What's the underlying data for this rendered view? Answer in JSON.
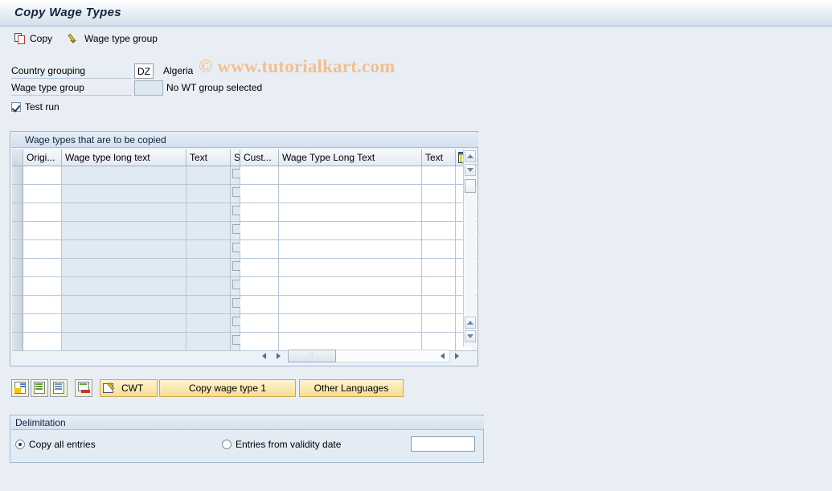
{
  "window": {
    "title": "Copy Wage Types"
  },
  "watermark": "© www.tutorialkart.com",
  "toolbar": {
    "copy_label": "Copy",
    "copy_icon": "copy-icon",
    "wage_type_group_label": "Wage type group",
    "wage_type_group_icon": "pencil-icon"
  },
  "selection": {
    "country_grouping": {
      "label": "Country grouping",
      "value": "DZ",
      "description": "Algeria"
    },
    "wage_type_group": {
      "label": "Wage type group",
      "value": "",
      "description": "No WT group selected"
    },
    "test_run": {
      "label": "Test run",
      "checked": true
    }
  },
  "table": {
    "panel_title": "Wage types that are to be copied",
    "columns": [
      {
        "key": "rowsel",
        "label": "",
        "type": "rowsel"
      },
      {
        "key": "orig",
        "label": "Origi...",
        "type": "white"
      },
      {
        "key": "wt_long_text",
        "label": "Wage type long text",
        "type": "blue"
      },
      {
        "key": "text1",
        "label": "Text",
        "type": "blue"
      },
      {
        "key": "s",
        "label": "S",
        "type": "chk"
      },
      {
        "key": "cust",
        "label": "Cust...",
        "type": "white"
      },
      {
        "key": "wt_long_text2",
        "label": "Wage Type Long Text",
        "type": "white"
      },
      {
        "key": "text2",
        "label": "Text",
        "type": "white"
      }
    ],
    "config_icon": "table-settings-icon",
    "row_count": 10,
    "rows": [],
    "vscroll": {
      "up_icon": "scroll-up-icon",
      "down_icon": "scroll-down-icon",
      "page_up_icon": "page-up-icon",
      "page_down_icon": "page-down-icon"
    },
    "hscroll": {
      "left_icon": "scroll-left-icon",
      "right_icon": "scroll-right-icon",
      "grip": "∷"
    }
  },
  "action_bar": {
    "icon_buttons": [
      {
        "name": "copy-from-icon-button",
        "icon": "document-import-icon"
      },
      {
        "name": "select-all-icon-button",
        "icon": "document-list-icon"
      },
      {
        "name": "deselect-icon-button",
        "icon": "document-plain-icon"
      },
      {
        "name": "delete-entry-icon-button",
        "icon": "document-delete-icon"
      }
    ],
    "cwt_button": {
      "label": "CWT",
      "icon": "cwt-edit-icon"
    },
    "copy_wage_type_button": {
      "label": "Copy wage type 1"
    },
    "other_languages_button": {
      "label": "Other Languages"
    }
  },
  "delimitation": {
    "title": "Delimitation",
    "option_all": {
      "label": "Copy all entries",
      "selected": true
    },
    "option_validity": {
      "label": "Entries from validity date",
      "selected": false
    },
    "validity_date_value": ""
  }
}
